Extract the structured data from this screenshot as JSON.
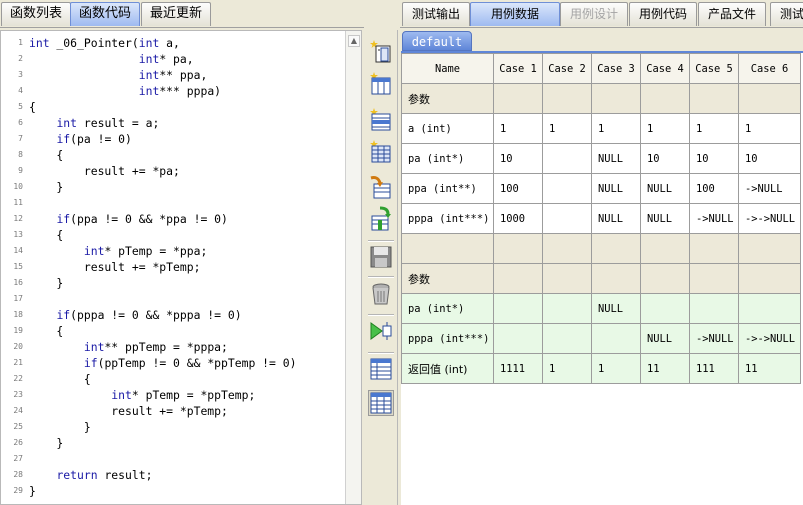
{
  "left_tabs": [
    "函数列表",
    "函数代码",
    "最近更新"
  ],
  "left_active_tab": "函数代码",
  "code_lines": [
    "int _06_Pointer(int a,",
    "                int* pa,",
    "                int** ppa,",
    "                int*** pppa)",
    "{",
    "    int result = a;",
    "    if(pa != 0)",
    "    {",
    "        result += *pa;",
    "    }",
    "",
    "    if(ppa != 0 && *ppa != 0)",
    "    {",
    "        int* pTemp = *ppa;",
    "        result += *pTemp;",
    "    }",
    "",
    "    if(pppa != 0 && *pppa != 0)",
    "    {",
    "        int** ppTemp = *pppa;",
    "        if(ppTemp != 0 && *ppTemp != 0)",
    "        {",
    "            int* pTemp = *ppTemp;",
    "            result += *pTemp;",
    "        }",
    "    }",
    "",
    "    return result;",
    "}"
  ],
  "toolbar_icons": [
    "add-param-icon",
    "add-column-icon",
    "insert-row-icon",
    "grid-icon",
    "import-icon",
    "export-icon",
    "save-icon",
    "trash-icon",
    "run-icon",
    "table-view-icon",
    "table-edit-icon"
  ],
  "right_tabs": [
    "测试输出",
    "用例数据",
    "用例设计",
    "用例代码",
    "产品文件",
    "测试"
  ],
  "right_active_tab": "用例数据",
  "right_disabled_tab": "用例设计",
  "subtab": "default",
  "grid": {
    "header": [
      "Name",
      "Case 1",
      "Case 2",
      "Case 3",
      "Case 4",
      "Case 5",
      "Case 6"
    ],
    "rows": [
      {
        "type": "sect",
        "cells": [
          "参数",
          "",
          "",
          "",
          "",
          "",
          ""
        ]
      },
      {
        "type": "in",
        "cells": [
          "a (int)",
          "1",
          "1",
          "1",
          "1",
          "1",
          "1"
        ]
      },
      {
        "type": "in",
        "cells": [
          "pa (int*)",
          "10",
          "",
          "NULL",
          "10",
          "10",
          "10"
        ]
      },
      {
        "type": "in",
        "cells": [
          "ppa (int**)",
          "100",
          "",
          "NULL",
          "NULL",
          "100",
          "->NULL"
        ]
      },
      {
        "type": "in",
        "cells": [
          "pppa (int***)",
          "1000",
          "",
          "NULL",
          "NULL",
          "->NULL",
          "->->NULL"
        ]
      },
      {
        "type": "sect",
        "cells": [
          "",
          "",
          "",
          "",
          "",
          "",
          ""
        ]
      },
      {
        "type": "sect",
        "cells": [
          "参数",
          "",
          "",
          "",
          "",
          "",
          ""
        ]
      },
      {
        "type": "out",
        "cells": [
          "pa (int*)",
          "",
          "",
          "NULL",
          "",
          "",
          ""
        ]
      },
      {
        "type": "out",
        "cells": [
          "pppa (int***)",
          "",
          "",
          "",
          "NULL",
          "->NULL",
          "->->NULL"
        ]
      },
      {
        "type": "out",
        "cells": [
          "返回值 (int)",
          "1111",
          "1",
          "1",
          "11",
          "111",
          "11"
        ]
      }
    ]
  },
  "colors": {
    "active_tab": "#9ebaf0",
    "keyword": "#1a1aa6",
    "section_row": "#ede9d9",
    "output_row": "#e8f9e6"
  }
}
